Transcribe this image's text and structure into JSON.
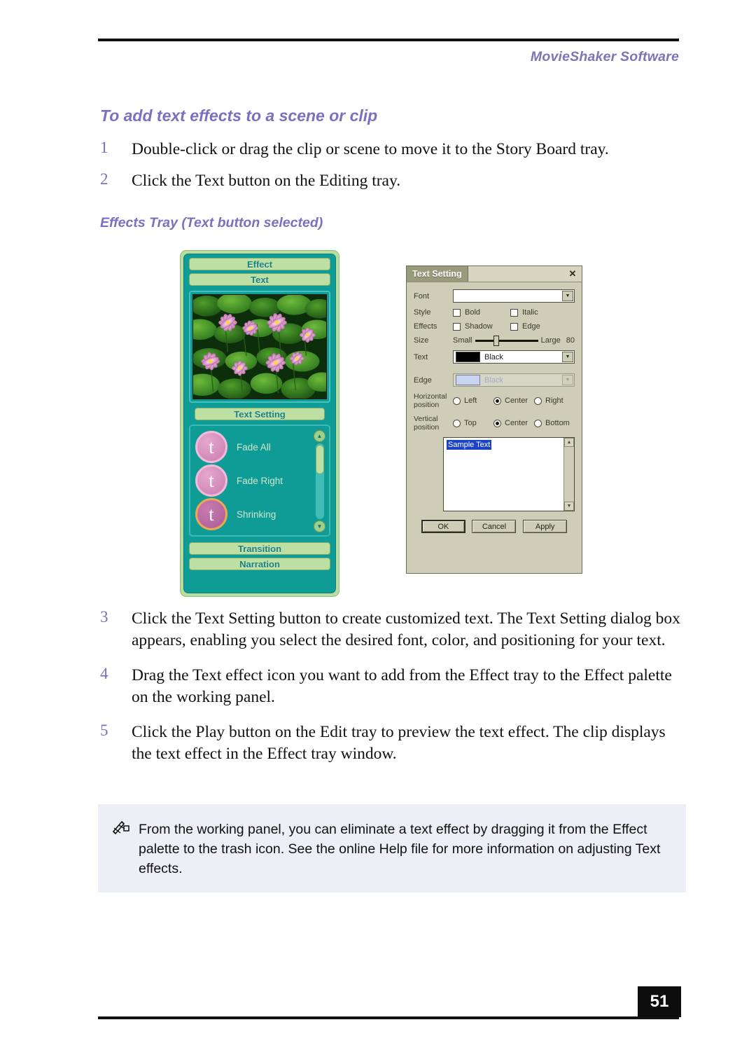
{
  "header": {
    "running_head": "MovieShaker Software"
  },
  "section": {
    "heading": "To add text effects to a scene or clip",
    "subheading": "Effects Tray (Text button selected)"
  },
  "steps_top": [
    {
      "num": "1",
      "text": "Double-click or drag the clip or scene to move it to the Story Board tray."
    },
    {
      "num": "2",
      "text": "Click the Text button on the Editing tray."
    }
  ],
  "steps_bottom": [
    {
      "num": "3",
      "text": "Click the Text Setting button to create customized text. The Text Setting dialog box appears, enabling you select the desired font, color, and positioning for your text."
    },
    {
      "num": "4",
      "text": "Drag the Text effect icon you want to add from the Effect tray to the Effect palette on the working panel."
    },
    {
      "num": "5",
      "text": "Click the Play button on the Edit tray to preview the text effect. The clip displays the text effect in the Effect tray window."
    }
  ],
  "note": {
    "icon": "note-pencil-icon",
    "text": "From the working panel, you can eliminate a text effect by dragging it from the Effect palette to the trash icon. See the online Help file for more information on adjusting Text effects."
  },
  "footer": {
    "page_number": "51"
  },
  "effects_tray": {
    "tab_effect": "Effect",
    "tab_text": "Text",
    "preview_alt": "water-lilies-video-preview",
    "text_setting_button": "Text Setting",
    "effects": [
      {
        "label": "Fade All",
        "glyph": "t",
        "style": "pink"
      },
      {
        "label": "Fade Right",
        "glyph": "t",
        "style": "pink"
      },
      {
        "label": "Shrinking",
        "glyph": "t",
        "style": "gold"
      }
    ],
    "btn_transition": "Transition",
    "btn_narration": "Narration",
    "scrollbar": {
      "up": "▲",
      "down": "▼"
    }
  },
  "text_setting_dialog": {
    "title": "Text Setting",
    "close": "✕",
    "font": {
      "label": "Font",
      "value": ""
    },
    "style": {
      "label": "Style",
      "bold": {
        "label": "Bold",
        "checked": false
      },
      "italic": {
        "label": "Italic",
        "checked": false
      }
    },
    "effects": {
      "label": "Effects",
      "shadow": {
        "label": "Shadow",
        "checked": false
      },
      "edge": {
        "label": "Edge",
        "checked": false
      }
    },
    "size": {
      "label": "Size",
      "min_label": "Small",
      "max_label": "Large",
      "value": "80"
    },
    "text_color": {
      "label": "Text",
      "value": "Black",
      "swatch": "#000000"
    },
    "edge_color": {
      "label": "Edge",
      "value": "Black",
      "swatch": "#c8d4f0",
      "disabled": true
    },
    "horizontal_position": {
      "label": "Horizontal position",
      "options": [
        "Left",
        "Center",
        "Right"
      ],
      "selected": "Center"
    },
    "vertical_position": {
      "label": "Vertical position",
      "options": [
        "Top",
        "Center",
        "Bottom"
      ],
      "selected": "Center"
    },
    "sample_text": "Sample Text",
    "buttons": {
      "ok": "OK",
      "cancel": "Cancel",
      "apply": "Apply"
    }
  },
  "colors": {
    "accent_purple": "#7b70c0",
    "tray_teal": "#0f9b96",
    "tray_green": "#bddfa4",
    "dialog_tan": "#cdcdb8"
  }
}
